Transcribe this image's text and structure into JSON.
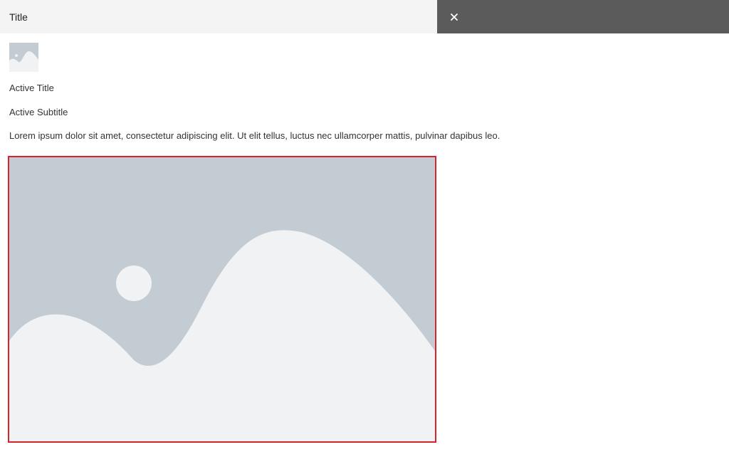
{
  "header": {
    "title": "Title",
    "close_icon": "close-icon"
  },
  "thumbnail": {
    "icon": "image-placeholder-icon"
  },
  "content": {
    "active_title": "Active Title",
    "active_subtitle": "Active Subtitle",
    "description": "Lorem ipsum dolor sit amet, consectetur adipiscing elit. Ut elit tellus, luctus nec ullamcorper mattis, pulvinar dapibus leo."
  },
  "main_image": {
    "icon": "image-placeholder-icon",
    "selected_border_color": "#d9232a"
  },
  "colors": {
    "header_background": "#f4f4f4",
    "close_background": "#5b5b5b",
    "placeholder_sky": "#c3cbd3",
    "placeholder_ground": "#f0f2f4"
  }
}
